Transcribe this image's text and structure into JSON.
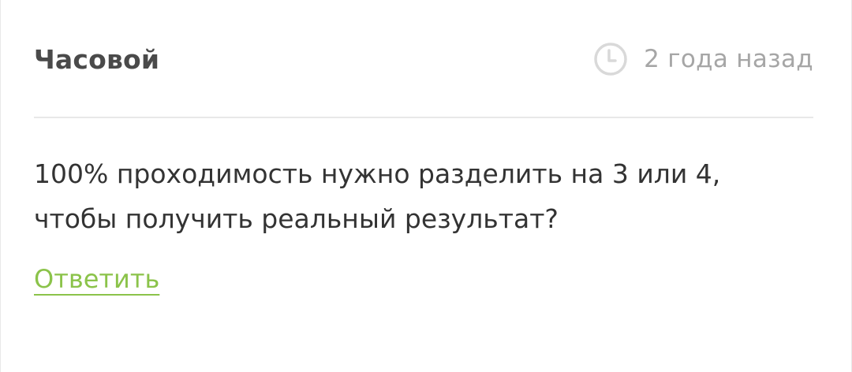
{
  "comment": {
    "author": "Часовой",
    "timestamp": "2 года назад",
    "timestamp_icon": "clock-icon",
    "text_lines": [
      "100% проходимость нужно разделить на 3 или 4,",
      "чтобы получить реальный результат?"
    ],
    "reply_label": "Ответить"
  },
  "colors": {
    "author": "#4a4a4a",
    "timestamp": "#a6a6a6",
    "body": "#333333",
    "reply_link": "#8bc34a",
    "divider": "#e8e8e8"
  }
}
